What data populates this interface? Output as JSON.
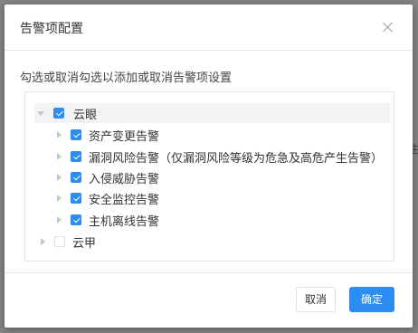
{
  "dialog": {
    "title": "告警项配置",
    "description": "勾选或取消勾选以添加或取消告警项设置"
  },
  "tree": {
    "root": {
      "label": "云眼",
      "checked": true,
      "expanded": true
    },
    "children": [
      {
        "label": "资产变更告警",
        "checked": true
      },
      {
        "label": "漏洞风险告警（仅漏洞风险等级为危急及高危产生告警）",
        "checked": true
      },
      {
        "label": "入侵威胁告警",
        "checked": true
      },
      {
        "label": "安全监控告警",
        "checked": true
      },
      {
        "label": "主机离线告警",
        "checked": true
      }
    ],
    "second_root": {
      "label": "云甲",
      "checked": false,
      "expanded": false
    }
  },
  "footer": {
    "cancel_label": "取消",
    "ok_label": "确定"
  },
  "colors": {
    "primary": "#2d8cf0"
  }
}
